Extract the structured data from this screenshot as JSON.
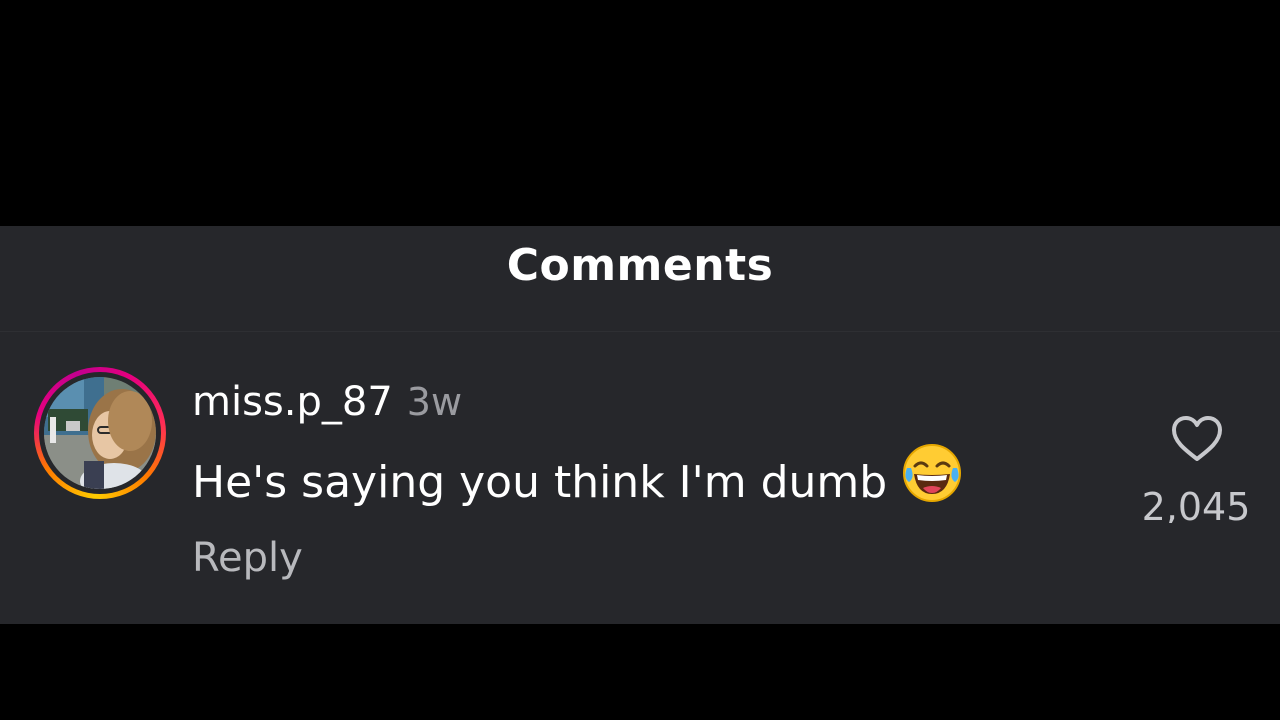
{
  "panel": {
    "title": "Comments"
  },
  "comment": {
    "username": "miss.p_87",
    "timestamp": "3w",
    "text": "He's saying you think I'm dumb",
    "emoji": "face-with-tears-of-joy-icon",
    "reply_label": "Reply",
    "like_count": "2,045",
    "avatar": "user-avatar-photo"
  },
  "colors": {
    "background": "#000000",
    "panel": "#26272b",
    "primary_text": "#ffffff",
    "secondary_text": "#9a9ba0",
    "story_ring_start": "#e6007e",
    "story_ring_end": "#ffcc00"
  }
}
